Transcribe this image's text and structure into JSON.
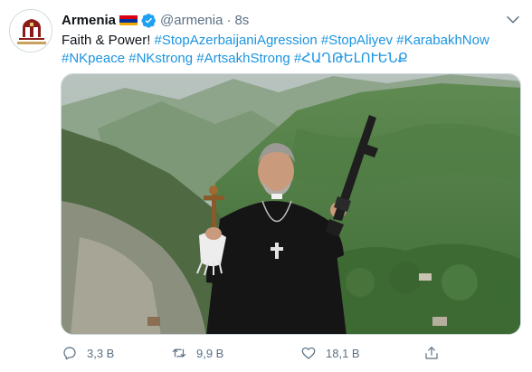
{
  "tweet": {
    "author_name": "Armenia",
    "handle": "@armenia",
    "separator": "·",
    "time": "8s",
    "text_plain": "Faith & Power!",
    "hashtags_line1": [
      "#StopAzerbaijaniAgression",
      "#StopAliyev",
      "#KarabakhNow"
    ],
    "hashtags_line2": [
      "#NKpeace",
      "#NKstrong",
      "#ArtsakhStrong",
      "#ՀԱՂԹԵԼՈՒԵՆՔ"
    ],
    "avatar_icon": "armenian-church-logo-icon",
    "flag_icon": "armenia-flag-icon",
    "verified_icon": "verified-badge-icon",
    "media_description_icon": "photo-priest-holding-cross-and-rifle-in-mountains"
  },
  "actions": {
    "reply": {
      "icon": "reply-icon",
      "count": "3,3 B"
    },
    "retweet": {
      "icon": "retweet-icon",
      "count": "9,9 B"
    },
    "like": {
      "icon": "like-icon",
      "count": "18,1 B"
    },
    "share": {
      "icon": "share-icon"
    }
  },
  "colors": {
    "link": "#1b95e0",
    "secondary_text": "#5b7083",
    "primary_text": "#0f1419",
    "verified": "#1da1f2",
    "flag": [
      "#d90012",
      "#0033a0",
      "#f2a800"
    ]
  }
}
